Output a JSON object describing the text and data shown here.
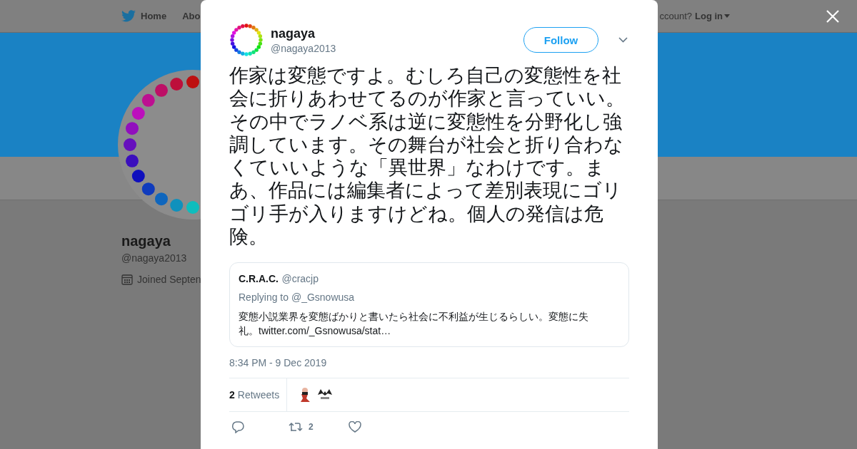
{
  "background_page": {
    "nav": {
      "items": [
        {
          "label": "Home"
        },
        {
          "label": "Abo"
        }
      ],
      "account_prompt": "ccount?",
      "login": "Log in"
    },
    "profile": {
      "name": "nagaya",
      "handle": "@nagaya2013",
      "joined": "Joined Septen"
    }
  },
  "tweet": {
    "author": {
      "name": "nagaya",
      "handle": "@nagaya2013"
    },
    "follow_button": "Follow",
    "text": "作家は変態ですよ。むしろ自己の変態性を社会に折りあわせてるのが作家と言っていい。その中でラノベ系は逆に変態性を分野化し強調しています。その舞台が社会と折り合わなくていいような「異世界」なわけです。まあ、作品には編集者によって差別表現にゴリゴリ手が入りますけどね。個人の発信は危険。",
    "quoted": {
      "name": "C.R.A.C.",
      "handle": "@cracjp",
      "replying_to": "Replying to @_Gsnowusa",
      "text": "変態小説業界を変態ばかりと書いたら社会に不利益が生じるらしい。変態に失礼。twitter.com/_Gsnowusa/stat…"
    },
    "timestamp": "8:34 PM - 9 Dec 2019",
    "retweets": {
      "count": "2",
      "label": "Retweets"
    },
    "actions": {
      "retweet_count": "2"
    }
  }
}
